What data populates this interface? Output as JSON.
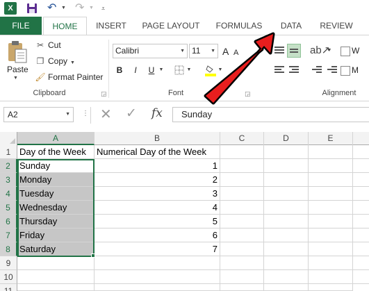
{
  "app": {
    "logo_letter": "X",
    "accent_color": "#217346"
  },
  "quick_access": {
    "icons": [
      "excel-logo-icon",
      "save-icon",
      "undo-icon",
      "redo-icon",
      "customize-icon"
    ]
  },
  "tabs": [
    {
      "label": "FILE"
    },
    {
      "label": "HOME"
    },
    {
      "label": "INSERT"
    },
    {
      "label": "PAGE LAYOUT"
    },
    {
      "label": "FORMULAS"
    },
    {
      "label": "DATA"
    },
    {
      "label": "REVIEW"
    }
  ],
  "ribbon": {
    "clipboard": {
      "paste_label": "Paste",
      "cut_label": "Cut",
      "copy_label": "Copy",
      "format_painter_label": "Format Painter",
      "group_label": "Clipboard"
    },
    "font": {
      "font_name": "Calibri",
      "font_size": "11",
      "bold_label": "B",
      "italic_label": "I",
      "underline_label": "U",
      "grow_label": "A",
      "shrink_label": "A",
      "group_label": "Font"
    },
    "alignment": {
      "group_label": "Alignment",
      "wrap_label": "W",
      "merge_label": "M"
    }
  },
  "formula_bar": {
    "name_box": "A2",
    "fx_label": "fx",
    "value": "Sunday"
  },
  "grid": {
    "columns": [
      "A",
      "B",
      "C",
      "D",
      "E"
    ],
    "rows": [
      "1",
      "2",
      "3",
      "4",
      "5",
      "6",
      "7",
      "8",
      "9",
      "10",
      "11"
    ],
    "cells": {
      "A1": "Day of the Week",
      "B1": "Numerical Day of the Week",
      "A2": "Sunday",
      "B2": "1",
      "A3": "Monday",
      "B3": "2",
      "A4": "Tuesday",
      "B4": "3",
      "A5": "Wednesday",
      "B5": "4",
      "A6": "Thursday",
      "B6": "5",
      "A7": "Friday",
      "B7": "6",
      "A8": "Saturday",
      "B8": "7"
    },
    "selected_range": "A2:A8"
  },
  "annotation": {
    "arrow_color": "#e81e1e",
    "points_to": "DATA tab"
  }
}
